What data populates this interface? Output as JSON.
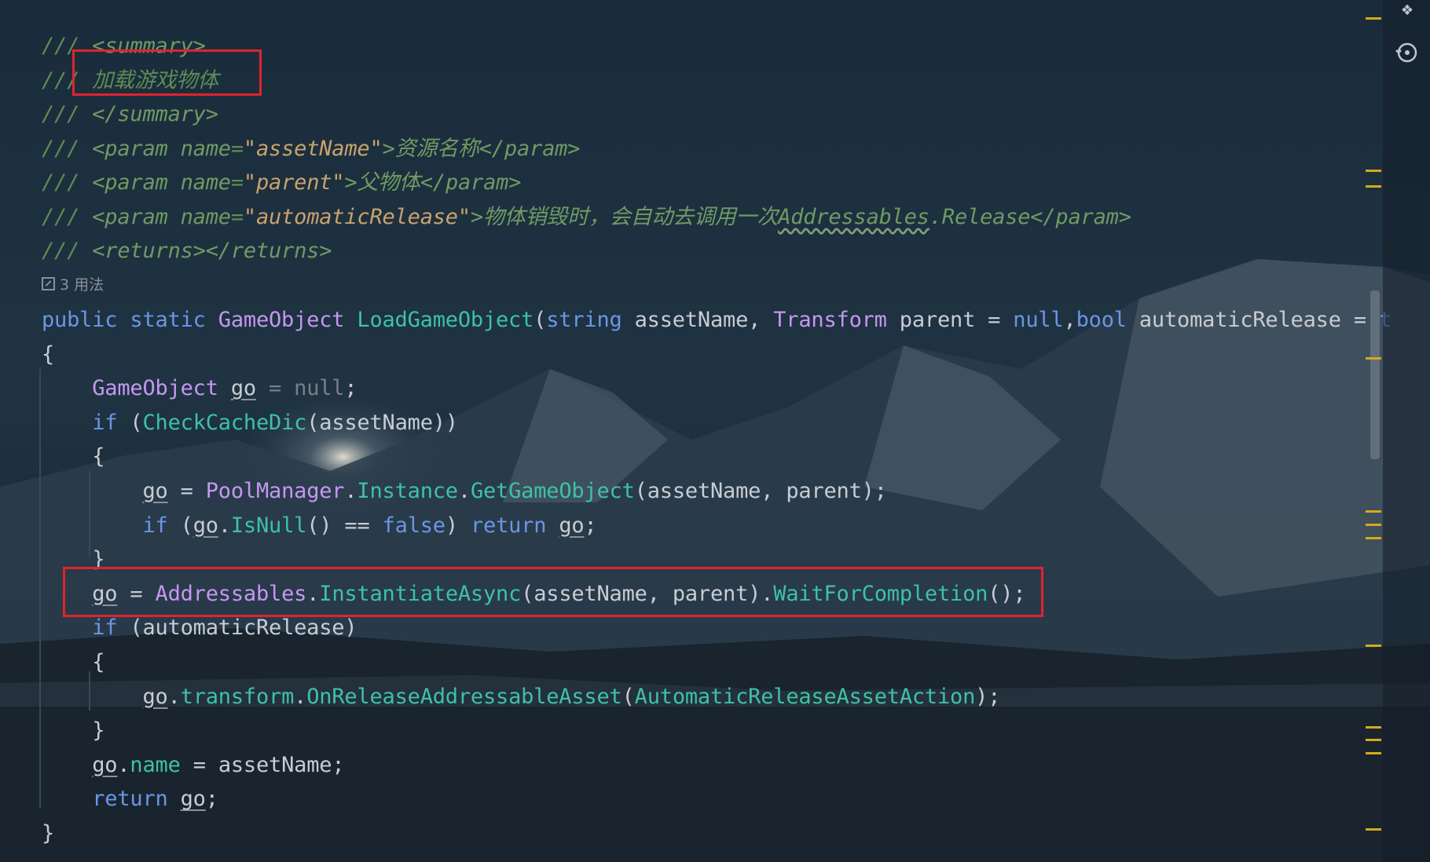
{
  "code": {
    "doc_lines": [
      [
        {
          "t": "/// ",
          "c": "c-doc"
        },
        {
          "t": "<summary>",
          "c": "c-tag"
        }
      ],
      [
        {
          "t": "/// ",
          "c": "c-doc"
        },
        {
          "t": "加载游戏物体",
          "c": "c-doc"
        }
      ],
      [
        {
          "t": "/// ",
          "c": "c-doc"
        },
        {
          "t": "</summary>",
          "c": "c-tag"
        }
      ],
      [
        {
          "t": "/// ",
          "c": "c-doc"
        },
        {
          "t": "<param ",
          "c": "c-tag"
        },
        {
          "t": "name",
          "c": "c-attr"
        },
        {
          "t": "=",
          "c": "c-doc"
        },
        {
          "t": "\"assetName\"",
          "c": "c-str"
        },
        {
          "t": ">资源名称</param>",
          "c": "c-tag"
        }
      ],
      [
        {
          "t": "/// ",
          "c": "c-doc"
        },
        {
          "t": "<param ",
          "c": "c-tag"
        },
        {
          "t": "name",
          "c": "c-attr"
        },
        {
          "t": "=",
          "c": "c-doc"
        },
        {
          "t": "\"parent\"",
          "c": "c-str"
        },
        {
          "t": ">父物体</param>",
          "c": "c-tag"
        }
      ],
      [
        {
          "t": "/// ",
          "c": "c-doc"
        },
        {
          "t": "<param ",
          "c": "c-tag"
        },
        {
          "t": "name",
          "c": "c-attr"
        },
        {
          "t": "=",
          "c": "c-doc"
        },
        {
          "t": "\"automaticRelease\"",
          "c": "c-str"
        },
        {
          "t": ">物体销毁时，会自动去调用一次",
          "c": "c-tag"
        },
        {
          "t": "Addressables",
          "c": "c-tag wavy"
        },
        {
          "t": ".Release</param>",
          "c": "c-tag"
        }
      ],
      [
        {
          "t": "/// ",
          "c": "c-doc"
        },
        {
          "t": "<returns></returns>",
          "c": "c-tag"
        }
      ]
    ],
    "usages_label": "3 用法",
    "code_lines": [
      [
        {
          "t": "public ",
          "c": "c-kw"
        },
        {
          "t": "static ",
          "c": "c-kw"
        },
        {
          "t": "GameObject ",
          "c": "c-type"
        },
        {
          "t": "LoadGameObject",
          "c": "c-meth"
        },
        {
          "t": "(",
          "c": "c-plain"
        },
        {
          "t": "string ",
          "c": "c-kw"
        },
        {
          "t": "assetName, ",
          "c": "c-plain"
        },
        {
          "t": "Transform ",
          "c": "c-type"
        },
        {
          "t": "parent = ",
          "c": "c-plain"
        },
        {
          "t": "null",
          "c": "c-kw"
        },
        {
          "t": ",",
          "c": "c-plain"
        },
        {
          "t": "bool ",
          "c": "c-kw"
        },
        {
          "t": "automaticRelease = ",
          "c": "c-plain"
        },
        {
          "t": "t",
          "c": "c-kw"
        }
      ],
      [
        {
          "t": "{",
          "c": "c-plain"
        }
      ],
      [
        {
          "t": "    ",
          "c": "c-plain"
        },
        {
          "t": "GameObject ",
          "c": "c-type"
        },
        {
          "t": "go",
          "c": "c-plain u"
        },
        {
          "t": " = ",
          "c": "c-dim"
        },
        {
          "t": "null",
          "c": "c-dim"
        },
        {
          "t": ";",
          "c": "c-plain"
        }
      ],
      [
        {
          "t": "    ",
          "c": "c-plain"
        },
        {
          "t": "if ",
          "c": "c-kw"
        },
        {
          "t": "(",
          "c": "c-plain"
        },
        {
          "t": "CheckCacheDic",
          "c": "c-meth"
        },
        {
          "t": "(assetName))",
          "c": "c-plain"
        }
      ],
      [
        {
          "t": "    {",
          "c": "c-plain"
        }
      ],
      [
        {
          "t": "        ",
          "c": "c-plain"
        },
        {
          "t": "go",
          "c": "c-plain u"
        },
        {
          "t": " = ",
          "c": "c-plain"
        },
        {
          "t": "PoolManager",
          "c": "c-type"
        },
        {
          "t": ".",
          "c": "c-plain"
        },
        {
          "t": "Instance",
          "c": "c-meth"
        },
        {
          "t": ".",
          "c": "c-plain"
        },
        {
          "t": "GetGameObject",
          "c": "c-meth"
        },
        {
          "t": "(assetName, parent);",
          "c": "c-plain"
        }
      ],
      [
        {
          "t": "        ",
          "c": "c-plain"
        },
        {
          "t": "if ",
          "c": "c-kw"
        },
        {
          "t": "(",
          "c": "c-plain"
        },
        {
          "t": "go",
          "c": "c-plain u"
        },
        {
          "t": ".",
          "c": "c-plain"
        },
        {
          "t": "IsNull",
          "c": "c-meth"
        },
        {
          "t": "() == ",
          "c": "c-plain"
        },
        {
          "t": "false",
          "c": "c-kw"
        },
        {
          "t": ") ",
          "c": "c-plain"
        },
        {
          "t": "return ",
          "c": "c-kw"
        },
        {
          "t": "go",
          "c": "c-plain u"
        },
        {
          "t": ";",
          "c": "c-plain"
        }
      ],
      [
        {
          "t": "    }",
          "c": "c-plain"
        }
      ],
      [
        {
          "t": "    ",
          "c": "c-plain"
        },
        {
          "t": "go",
          "c": "c-plain u"
        },
        {
          "t": " = ",
          "c": "c-plain"
        },
        {
          "t": "Addressables",
          "c": "c-type"
        },
        {
          "t": ".",
          "c": "c-plain"
        },
        {
          "t": "InstantiateAsync",
          "c": "c-meth"
        },
        {
          "t": "(assetName, parent).",
          "c": "c-plain"
        },
        {
          "t": "WaitForCompletion",
          "c": "c-meth"
        },
        {
          "t": "();",
          "c": "c-plain"
        }
      ],
      [
        {
          "t": "    ",
          "c": "c-plain"
        },
        {
          "t": "if ",
          "c": "c-kw"
        },
        {
          "t": "(automaticRelease)",
          "c": "c-plain"
        }
      ],
      [
        {
          "t": "    {",
          "c": "c-plain"
        }
      ],
      [
        {
          "t": "        ",
          "c": "c-plain"
        },
        {
          "t": "go",
          "c": "c-plain u"
        },
        {
          "t": ".",
          "c": "c-plain"
        },
        {
          "t": "transform",
          "c": "c-meth"
        },
        {
          "t": ".",
          "c": "c-plain"
        },
        {
          "t": "OnReleaseAddressableAsset",
          "c": "c-meth"
        },
        {
          "t": "(",
          "c": "c-plain"
        },
        {
          "t": "AutomaticReleaseAssetAction",
          "c": "c-meth"
        },
        {
          "t": ");",
          "c": "c-plain"
        }
      ],
      [
        {
          "t": "    }",
          "c": "c-plain"
        }
      ],
      [
        {
          "t": "    ",
          "c": "c-plain"
        },
        {
          "t": "go",
          "c": "c-plain u"
        },
        {
          "t": ".",
          "c": "c-plain"
        },
        {
          "t": "name",
          "c": "c-meth"
        },
        {
          "t": " = assetName;",
          "c": "c-plain"
        }
      ],
      [
        {
          "t": "    ",
          "c": "c-plain"
        },
        {
          "t": "return ",
          "c": "c-kw"
        },
        {
          "t": "go",
          "c": "c-plain u"
        },
        {
          "t": ";",
          "c": "c-plain"
        }
      ],
      [
        {
          "t": "}",
          "c": "c-plain"
        }
      ]
    ]
  },
  "gutter": {
    "icons": [
      "inspection-widget-icon",
      "history-icon"
    ]
  },
  "colors": {
    "highlight_box": "#e0232e",
    "marker": "#d6a91b"
  }
}
